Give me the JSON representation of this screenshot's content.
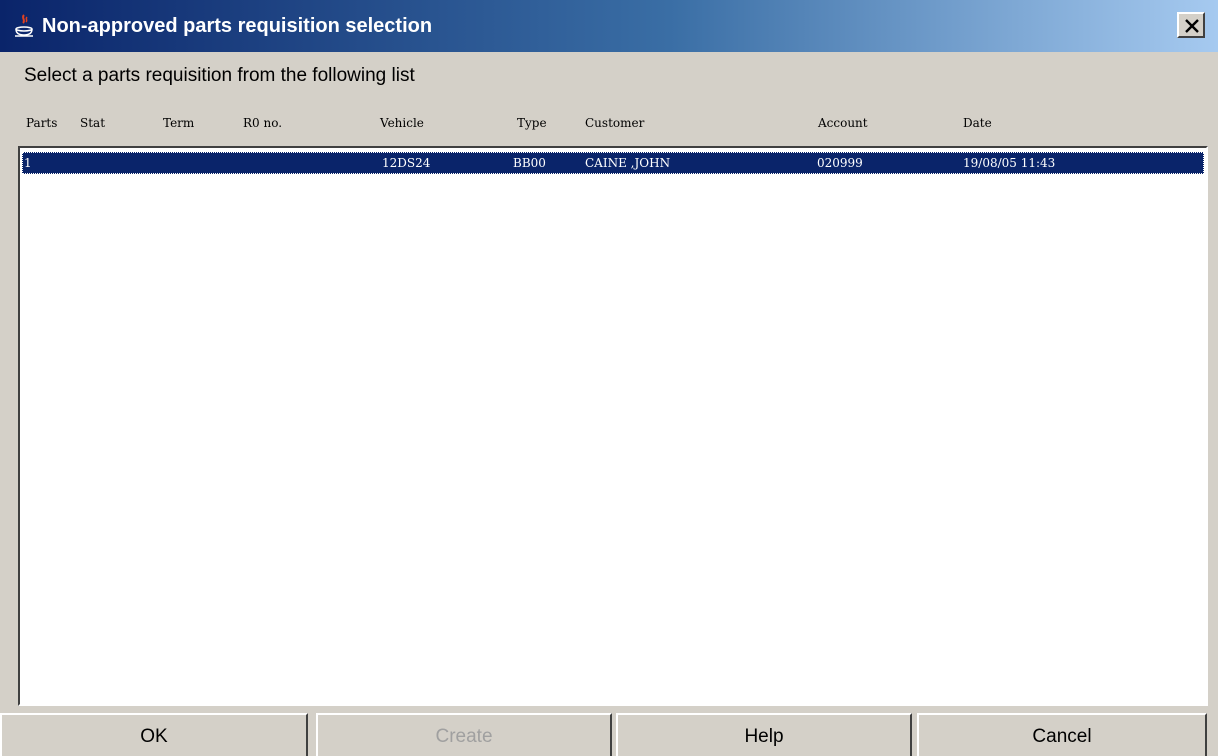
{
  "window": {
    "title": "Non-approved parts requisition selection",
    "icon": "java-cup-icon",
    "close_glyph": "✕"
  },
  "prompt": "Select a parts requisition from the following list",
  "columns": {
    "parts": "Parts",
    "stat": "Stat",
    "term": "Term",
    "ro_no": "R0 no.",
    "vehicle": "Vehicle",
    "type": "Type",
    "customer": "Customer",
    "account": "Account",
    "date": "Date"
  },
  "rows": [
    {
      "parts": "1",
      "stat": "",
      "term": "",
      "ro_no": "",
      "vehicle": "12DS24",
      "type": "BB00",
      "customer": "CAINE ,JOHN",
      "account": "020999",
      "date": "19/08/05 11:43",
      "selected": true
    }
  ],
  "buttons": {
    "ok": "OK",
    "create": "Create",
    "help": "Help",
    "cancel": "Cancel"
  },
  "colors": {
    "title_gradient_start": "#0a246a",
    "title_gradient_end": "#a6caf0",
    "selection": "#0a246a",
    "face": "#d4d0c8"
  }
}
